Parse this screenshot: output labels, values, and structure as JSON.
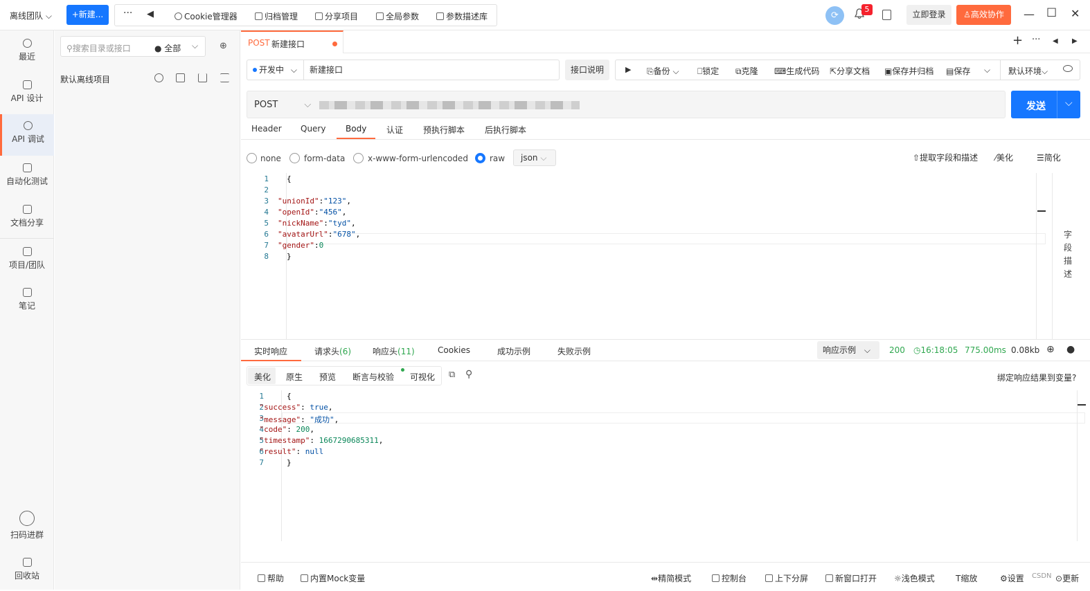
{
  "topbar": {
    "team": "离线团队",
    "new_button": "+新建...",
    "more": "···",
    "tools": [
      "Cookie管理器",
      "归档管理",
      "分享项目",
      "全局参数",
      "参数描述库"
    ],
    "notification_count": "5",
    "login": "立即登录",
    "collab": "高效协作"
  },
  "rail": {
    "items": [
      "最近",
      "API 设计",
      "API 调试",
      "自动化测试",
      "文档分享",
      "项目/团队",
      "笔记"
    ],
    "bottom": [
      "扫码进群",
      "回收站"
    ]
  },
  "tree": {
    "search_placeholder": "搜索目录或接口",
    "scope": "全部",
    "project": "默认离线项目"
  },
  "tab": {
    "method": "POST",
    "name": "新建接口"
  },
  "request": {
    "status": "开发中",
    "name": "新建接口",
    "desc_button": "接口说明",
    "actions": [
      "备份",
      "锁定",
      "克隆",
      "生成代码",
      "分享文档",
      "保存并归档",
      "保存"
    ],
    "env": "默认环境",
    "method": "POST",
    "send": "发送",
    "tabs": [
      "Header",
      "Query",
      "Body",
      "认证",
      "预执行脚本",
      "后执行脚本"
    ],
    "body_modes": [
      "none",
      "form-data",
      "x-www-form-urlencoded",
      "raw"
    ],
    "format": "json",
    "body_tools": [
      "提取字段和描述",
      "美化",
      "简化"
    ],
    "field_desc": "字段描述",
    "line_numbers": [
      "1",
      "2",
      "3",
      "4",
      "5",
      "6",
      "7",
      "8"
    ],
    "body_lines": [
      {
        "key": "",
        "value": "",
        "raw": "{"
      },
      {
        "key": "",
        "value": "",
        "raw": ""
      },
      {
        "key": "\"unionId\"",
        "value": "\"123\"",
        "tail": ","
      },
      {
        "key": "\"openId\"",
        "value": "\"456\"",
        "tail": ","
      },
      {
        "key": "\"nickName\"",
        "value": "\"tyd\"",
        "tail": ","
      },
      {
        "key": "\"avatarUrl\"",
        "value": "\"678\"",
        "tail": ","
      },
      {
        "key": "\"gender\"",
        "value": "0",
        "tail": ""
      },
      {
        "key": "",
        "value": "",
        "raw": "}"
      }
    ]
  },
  "response": {
    "tabs": [
      "实时响应",
      "请求头(6)",
      "响应头(11)",
      "Cookies",
      "成功示例",
      "失败示例"
    ],
    "example": "响应示例",
    "status_code": "200",
    "time": "16:18:05",
    "duration": "775.00ms",
    "size": "0.08kb",
    "view_tabs": [
      "美化",
      "原生",
      "预览",
      "断言与校验",
      "可视化"
    ],
    "bind_var": "绑定响应结果到变量?",
    "line_numbers": [
      "1",
      "2",
      "3",
      "4",
      "5",
      "6",
      "7"
    ],
    "lines": [
      {
        "raw": "{"
      },
      {
        "key": "\"success\"",
        "value": "true",
        "tail": ","
      },
      {
        "key": "\"message\"",
        "value": "\"成功\"",
        "tail": ","
      },
      {
        "key": "\"code\"",
        "value": "200",
        "tail": ","
      },
      {
        "key": "\"timestamp\"",
        "value": "1667290685311",
        "tail": ","
      },
      {
        "key": "\"result\"",
        "value": "null",
        "tail": ""
      },
      {
        "raw": "}"
      }
    ]
  },
  "footer": {
    "left": [
      "帮助",
      "内置Mock变量"
    ],
    "right": [
      "精简模式",
      "控制台",
      "上下分屏",
      "新窗口打开",
      "浅色模式",
      "缩放",
      "设置"
    ],
    "watermark": "CSDN",
    "update": "更新"
  }
}
